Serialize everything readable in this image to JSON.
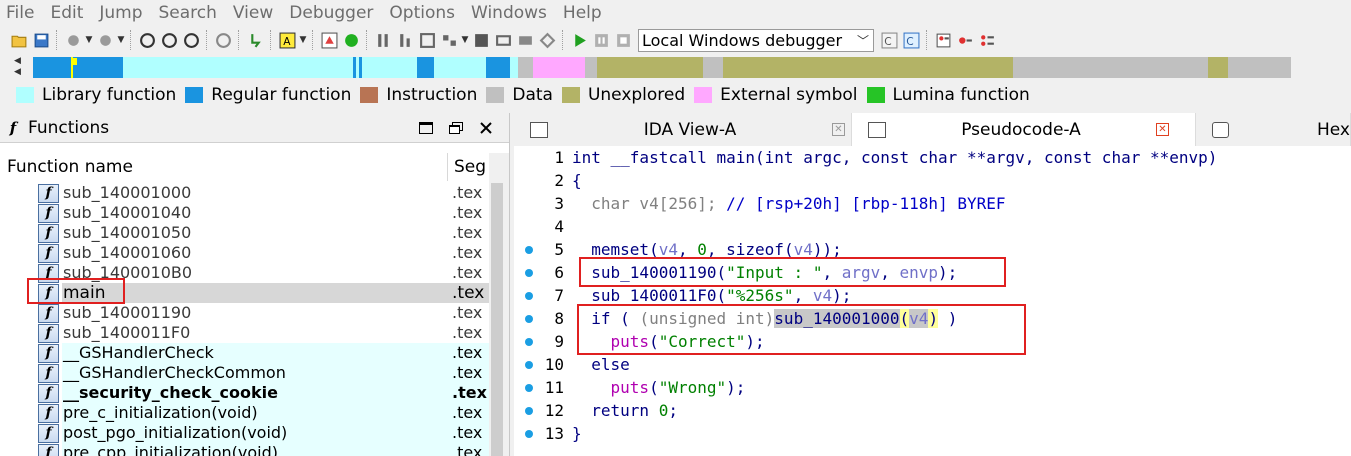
{
  "menubar": {
    "items": [
      "File",
      "Edit",
      "Jump",
      "Search",
      "View",
      "Debugger",
      "Options",
      "Windows",
      "Help"
    ]
  },
  "toolbar": {
    "debugger_select": "Local Windows debugger"
  },
  "navband": {
    "segments": [
      {
        "color": "#1a94e0",
        "width": 38
      },
      {
        "color": "#ffff00",
        "width": 2
      },
      {
        "color": "#1a94e0",
        "width": 50
      },
      {
        "color": "#b0ffff",
        "width": 230
      },
      {
        "color": "#1a94e0",
        "width": 3
      },
      {
        "color": "#b0ffff",
        "width": 3
      },
      {
        "color": "#1a94e0",
        "width": 3
      },
      {
        "color": "#b0ffff",
        "width": 55
      },
      {
        "color": "#1a94e0",
        "width": 17
      },
      {
        "color": "#b0ffff",
        "width": 52
      },
      {
        "color": "#1a94e0",
        "width": 24
      },
      {
        "color": "#b0ffff",
        "width": 8
      },
      {
        "color": "#c0c0c0",
        "width": 15
      },
      {
        "color": "#ffa8ff",
        "width": 52
      },
      {
        "color": "#c0c0c0",
        "width": 12
      },
      {
        "color": "#b3b366",
        "width": 106
      },
      {
        "color": "#c0c0c0",
        "width": 20
      },
      {
        "color": "#b3b366",
        "width": 290
      },
      {
        "color": "#c0c0c0",
        "width": 195
      },
      {
        "color": "#b3b366",
        "width": 20
      },
      {
        "color": "#c0c0c0",
        "width": 63
      }
    ]
  },
  "legend": [
    {
      "label": "Library function",
      "color": "#b0ffff"
    },
    {
      "label": "Regular function",
      "color": "#1a94e0"
    },
    {
      "label": "Instruction",
      "color": "#b87454"
    },
    {
      "label": "Data",
      "color": "#c0c0c0"
    },
    {
      "label": "Unexplored",
      "color": "#b3b366"
    },
    {
      "label": "External symbol",
      "color": "#ffa8ff"
    },
    {
      "label": "Lumina function",
      "color": "#26c426"
    }
  ],
  "functions_panel": {
    "title": "Functions",
    "col_name": "Function name",
    "col_seg": "Seg",
    "rows": [
      {
        "name": "sub_140001000",
        "seg": ".tex",
        "kind": "regular"
      },
      {
        "name": "sub_140001040",
        "seg": ".tex",
        "kind": "regular"
      },
      {
        "name": "sub_140001050",
        "seg": ".tex",
        "kind": "regular"
      },
      {
        "name": "sub_140001060",
        "seg": ".tex",
        "kind": "regular"
      },
      {
        "name": "sub_1400010B0",
        "seg": ".tex",
        "kind": "regular"
      },
      {
        "name": "main",
        "seg": ".tex",
        "kind": "selected"
      },
      {
        "name": "sub_140001190",
        "seg": ".tex",
        "kind": "regular"
      },
      {
        "name": "sub_1400011F0",
        "seg": ".tex",
        "kind": "regular"
      },
      {
        "name": "__GSHandlerCheck",
        "seg": ".tex",
        "kind": "library"
      },
      {
        "name": "__GSHandlerCheckCommon",
        "seg": ".tex",
        "kind": "library"
      },
      {
        "name": "__security_check_cookie",
        "seg": ".tex",
        "kind": "library-bold"
      },
      {
        "name": "pre_c_initialization(void)",
        "seg": ".tex",
        "kind": "library"
      },
      {
        "name": "post_pgo_initialization(void)",
        "seg": ".tex",
        "kind": "library"
      },
      {
        "name": "pre_cpp_initialization(void)",
        "seg": ".tex",
        "kind": "library"
      }
    ]
  },
  "tabs": {
    "ida": "IDA View-A",
    "pseudo": "Pseudocode-A",
    "hex": "Hex"
  },
  "code": {
    "line_numbers": [
      "1",
      "2",
      "3",
      "4",
      "5",
      "6",
      "7",
      "8",
      "9",
      "10",
      "11",
      "12",
      "13"
    ],
    "dots": [
      false,
      false,
      false,
      false,
      true,
      true,
      true,
      true,
      true,
      true,
      true,
      true,
      true
    ]
  }
}
